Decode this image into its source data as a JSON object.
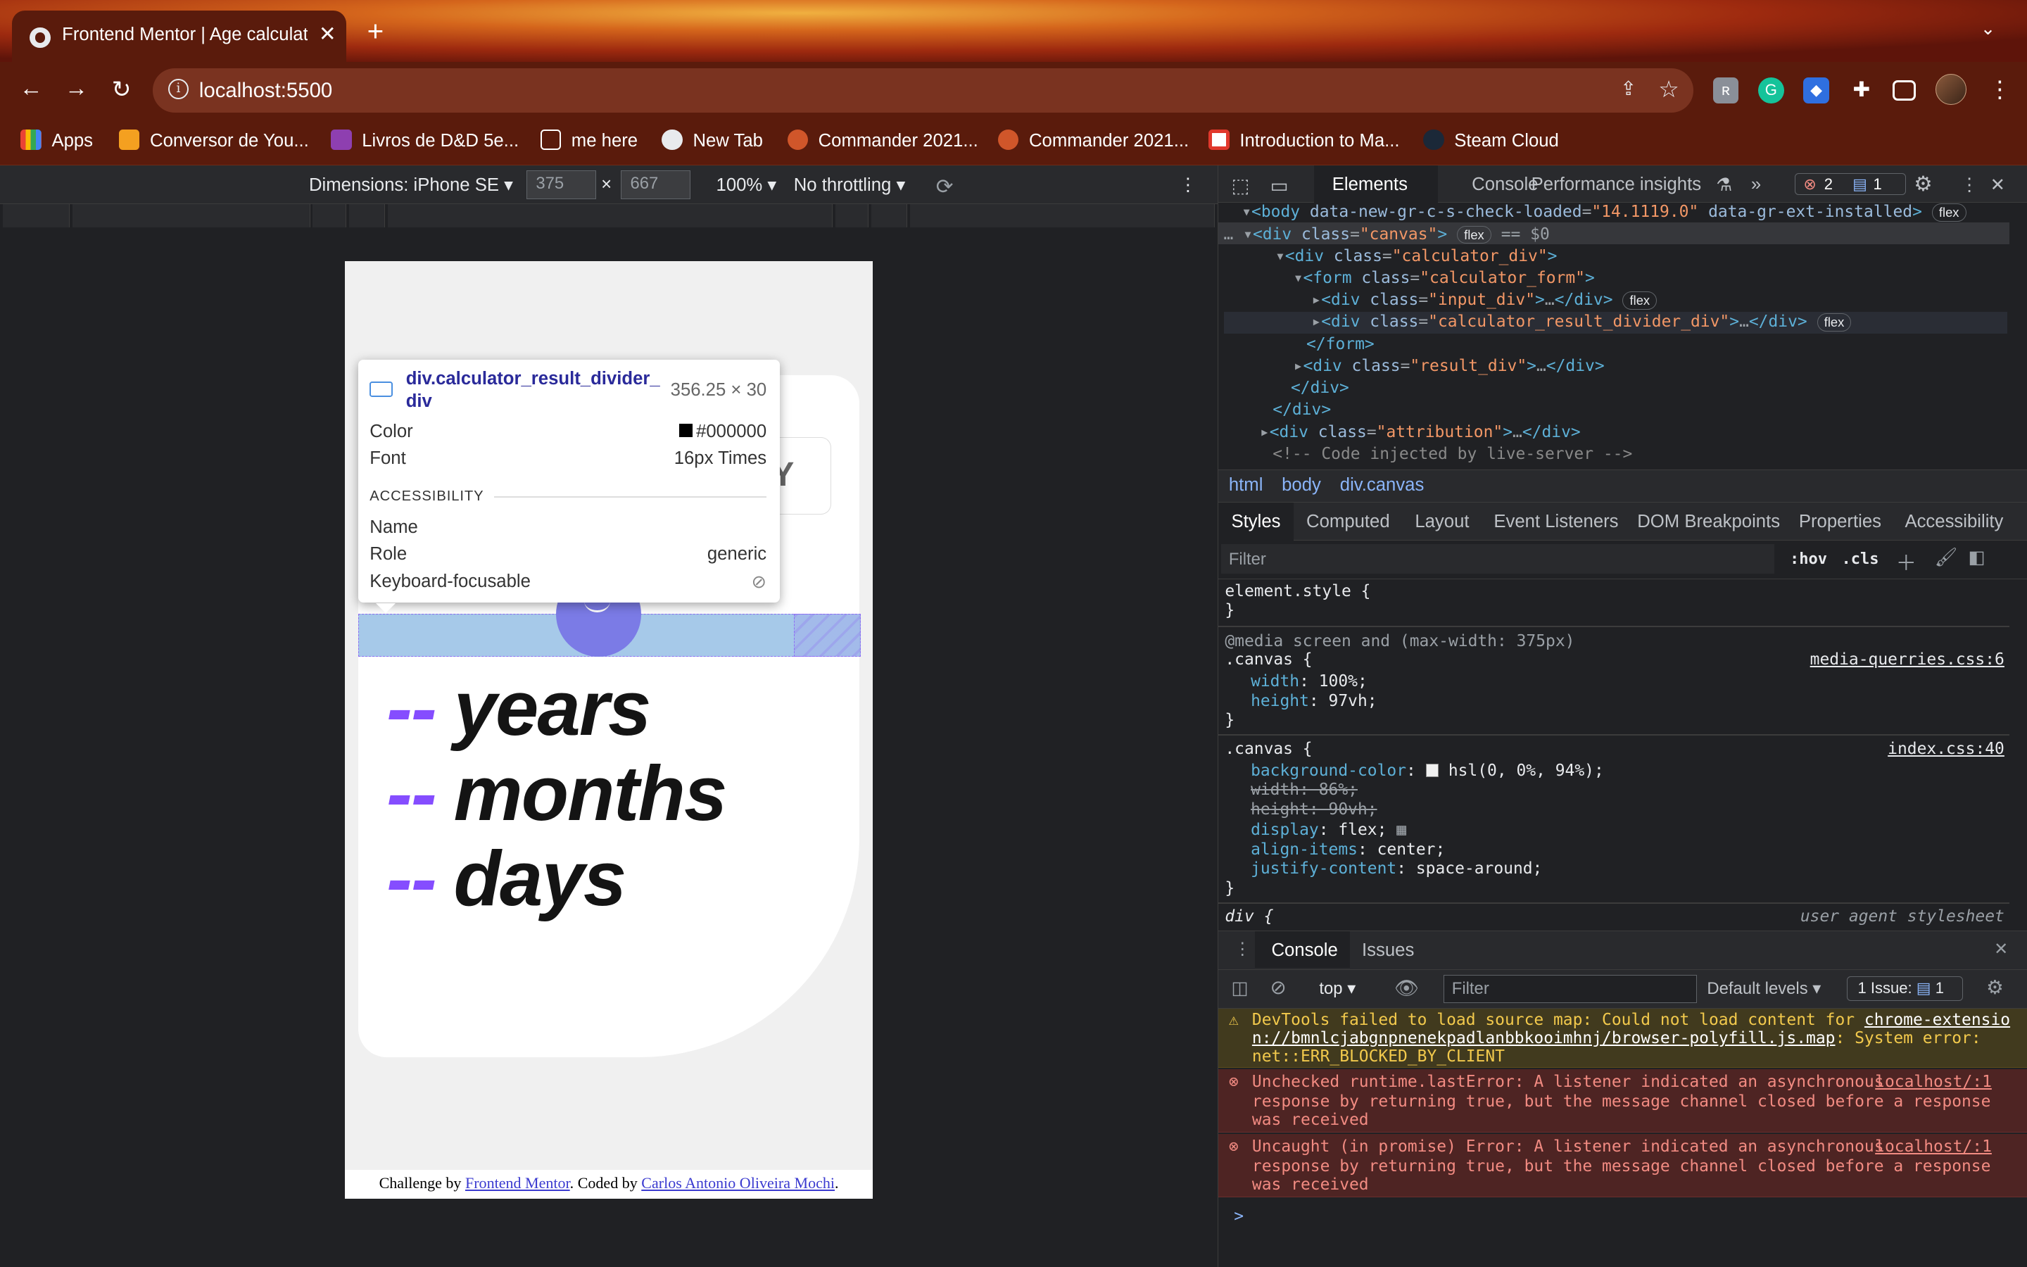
{
  "browser": {
    "tab_title": "Frontend Mentor | Age calculat",
    "new_tab": "+",
    "url": "localhost:5500",
    "bookmarks": [
      "Apps",
      "Conversor de You...",
      "Livros de D&D 5e...",
      "me here",
      "New Tab",
      "Commander 2021...",
      "Commander 2021...",
      "Introduction to Ma...",
      "Steam Cloud"
    ]
  },
  "device_toolbar": {
    "dimensions_label": "Dimensions: iPhone SE",
    "width": "375",
    "times": "×",
    "height": "667",
    "zoom": "100%",
    "throttling": "No throttling"
  },
  "page": {
    "input_partial": "Y",
    "results": [
      {
        "dash": "--",
        "unit": "years"
      },
      {
        "dash": "--",
        "unit": "months"
      },
      {
        "dash": "--",
        "unit": "days"
      }
    ],
    "attribution_prefix": "Challenge by ",
    "attribution_link1": "Frontend Mentor",
    "attribution_middle": ". Coded by ",
    "attribution_link2": "Carlos Antonio Oliveira Mochi",
    "attribution_suffix": "."
  },
  "tooltip": {
    "selector": "div.calculator_result_divider_div",
    "size": "356.25 × 30",
    "color_label": "Color",
    "color_value": "#000000",
    "font_label": "Font",
    "font_value": "16px Times",
    "section": "ACCESSIBILITY",
    "name_label": "Name",
    "role_label": "Role",
    "role_value": "generic",
    "focus_label": "Keyboard-focusable"
  },
  "devtools": {
    "tabs": [
      "Elements",
      "Console",
      "Performance insights"
    ],
    "error_count": "2",
    "msg_count": "1",
    "dom": {
      "body_attr1": "data-new-gr-c-s-check-loaded",
      "body_val1": "\"14.1119.0\"",
      "body_attr2": "data-gr-ext-installed",
      "canvas_class": "\"canvas\"",
      "eq": "== $0",
      "calc_div": "\"calculator_div\"",
      "form_class": "\"calculator_form\"",
      "input_div": "\"input_div\"",
      "divider_div": "\"calculator_result_divider_div\"",
      "result_div": "\"result_div\"",
      "attribution": "\"attribution\"",
      "comment": "<!-- Code injected by live-server -->",
      "flex": "flex"
    },
    "breadcrumbs": [
      "html",
      "body",
      "div.canvas"
    ],
    "subtabs": [
      "Styles",
      "Computed",
      "Layout",
      "Event Listeners",
      "DOM Breakpoints",
      "Properties",
      "Accessibility"
    ],
    "filter_placeholder": "Filter",
    "hov": ":hov",
    "cls": ".cls",
    "styles": {
      "element_style": "element.style {",
      "close": "}",
      "media": "@media screen and (max-width: 375px)",
      "canvas_sel": ".canvas {",
      "src1": "media-querries.css:6",
      "src2": "index.css:40",
      "w100": "width",
      "w100v": "100%;",
      "h97": "height",
      "h97v": "97vh;",
      "bg": "background-color",
      "bgv": "hsl(0, 0%, 94%);",
      "w86": "width: 86%;",
      "h90": "height: 90vh;",
      "disp": "display",
      "dispv": "flex;",
      "ai": "align-items",
      "aiv": "center;",
      "jc": "justify-content",
      "jcv": "space-around;",
      "div_sel": "div {",
      "ua": "user agent stylesheet"
    },
    "console_tabs": [
      "Console",
      "Issues"
    ],
    "console_context": "top",
    "console_filter": "Filter",
    "levels": "Default levels",
    "issues": "1 Issue:",
    "issues_count": "1",
    "messages": {
      "warn1": "DevTools failed to load source map: Could not load content for ",
      "warn_link": "chrome-extensio",
      "warn_link2": "n://bmnlcjabgnpnenekpadlanbbkooimhnj/browser-polyfill.js.map",
      "warn2": ": System error:",
      "warn3": "net::ERR_BLOCKED_BY_CLIENT",
      "err1_a": "Unchecked runtime.lastError: A listener indicated an asynchronous",
      "err1_b": "response by returning true, but the message channel closed before a response",
      "err1_c": "was received",
      "err2_a": "Uncaught (in promise) Error: A listener indicated an asynchronous",
      "err2_b": "response by returning true, but the message channel closed before a response",
      "err2_c": "was received",
      "src": "localhost/:1",
      "prompt": ">"
    }
  },
  "colors": {
    "accent_purple": "#854dff",
    "highlight_blue": "#6fa8dc",
    "page_bg": "#f0f0f0"
  }
}
